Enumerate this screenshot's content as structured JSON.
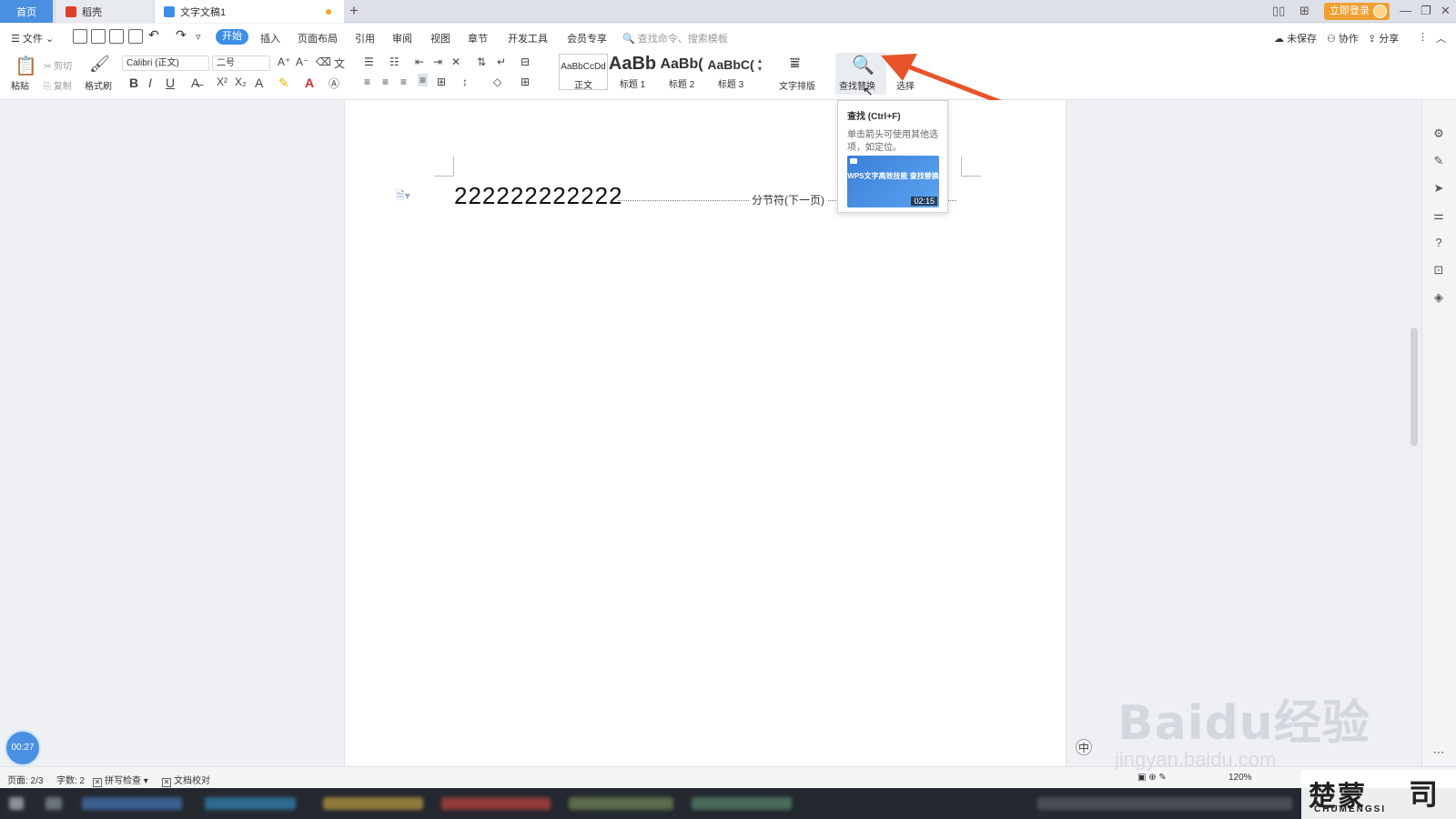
{
  "tabs": {
    "home": "首页",
    "daoke": "稻壳",
    "doc": "文字文稿1",
    "new_tab": "+"
  },
  "titlebar": {
    "login": "立即登录"
  },
  "menu": {
    "file": "文件",
    "start": "开始",
    "insert": "插入",
    "layout": "页面布局",
    "reference": "引用",
    "review": "审阅",
    "view": "视图",
    "chapter": "章节",
    "devtools": "开发工具",
    "vip": "会员专享",
    "search_placeholder": "查找命令、搜索模板",
    "unsaved": "未保存",
    "collab": "协作",
    "share": "分享"
  },
  "ribbon": {
    "paste": "粘贴",
    "cut": "剪切",
    "copy": "复制",
    "format_painter": "格式刷",
    "font_name": "Calibri (正文)",
    "font_size": "二号",
    "styles": [
      {
        "sample": "AaBbCcDd",
        "name": "正文"
      },
      {
        "sample": "AaBb",
        "name": "标题 1"
      },
      {
        "sample": "AaBb(",
        "name": "标题 2"
      },
      {
        "sample": "AaBbC(",
        "name": "标题 3"
      }
    ],
    "text_layout": "文字排版",
    "find_replace": "查找替换",
    "select": "选择"
  },
  "tooltip": {
    "title": "查找 (Ctrl+F)",
    "desc": "单击箭头可使用其他选项，如定位。",
    "video_title": "WPS文字高效技能 查找替换",
    "video_time": "02:15"
  },
  "document": {
    "text": "222222222222",
    "section_break": "分节符(下一页)"
  },
  "status": {
    "page": "页面: 2/3",
    "words": "字数: 2",
    "spell": "拼写检查",
    "proof": "文档校对",
    "zoom": "120%"
  },
  "timer": "00:27",
  "watermark": {
    "main": "Baidu经验",
    "sub": "jingyan.baidu.com",
    "corner": "楚蒙",
    "corner_sub": "CHUMENGSI"
  },
  "colors": {
    "accent": "#3d8ee8",
    "login": "#f0a030",
    "arrow": "#e8532a"
  }
}
